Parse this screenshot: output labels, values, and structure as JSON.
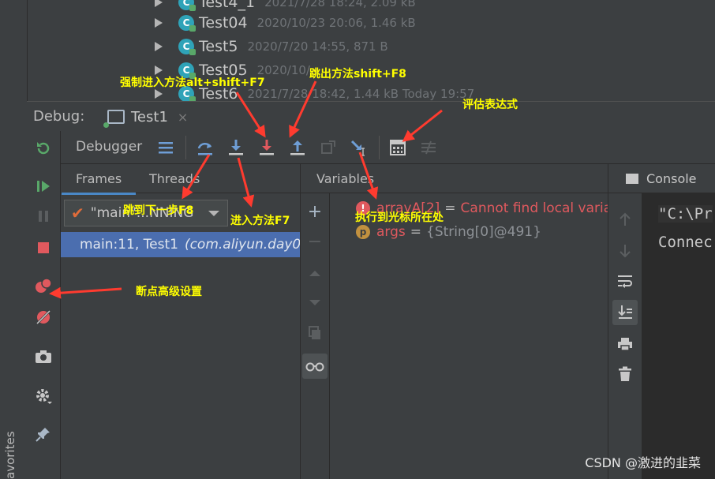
{
  "project_tree": {
    "rows": [
      {
        "name": "Test4_1",
        "meta": "2021/7/28 18:24, 2.09 kB"
      },
      {
        "name": "Test04",
        "meta": "2020/10/23 20:06, 1.46 kB"
      },
      {
        "name": "Test5",
        "meta": "2020/7/20 14:55, 871 B"
      },
      {
        "name": "Test05",
        "meta": "2020/10/..."
      },
      {
        "name": "Test6",
        "meta": "2021/7/28 18:42, 1.44 kB Today 19:57"
      }
    ]
  },
  "debug": {
    "label": "Debug:",
    "tab_label": "Test1",
    "tab_close": "×"
  },
  "toolbar": {
    "debugger_label": "Debugger"
  },
  "frames": {
    "tab_frames": "Frames",
    "tab_threads": "Threads",
    "thread_value": "\"main\"...NNING",
    "frame_method": "main:11, Test1",
    "frame_package": "(com.aliyun.day0..."
  },
  "variables": {
    "tab_label": "Variables",
    "rows": [
      {
        "icon": "!",
        "name": "arrayA[2]",
        "eq": "=",
        "value": "Cannot find local varia...",
        "color": "#e0595e"
      },
      {
        "icon": "p",
        "name": "args",
        "eq": "=",
        "value": "{String[0]@491}",
        "color": "#c8c8c8"
      }
    ]
  },
  "console": {
    "tab_label": "Console",
    "lines": [
      "\"C:\\Pr",
      "Connec"
    ]
  },
  "sidebar": {
    "favorites": "avorites"
  },
  "annotations": {
    "force_step_into": "强制进入方法alt+shift+F7",
    "step_out": "跳出方法shift+F8",
    "evaluate": "评估表达式",
    "step_over": "跳到下一步F8",
    "step_into": "进入方法F7",
    "run_to_cursor": "执行到光标所在处",
    "breakpoint_settings": "断点高级设置"
  },
  "watermark": "CSDN @激进的韭菜",
  "colors": {
    "accent": "#4a88c7",
    "selection": "#4b6eaf",
    "annotation_text": "#ffff00",
    "arrow": "#ff3b2f"
  }
}
